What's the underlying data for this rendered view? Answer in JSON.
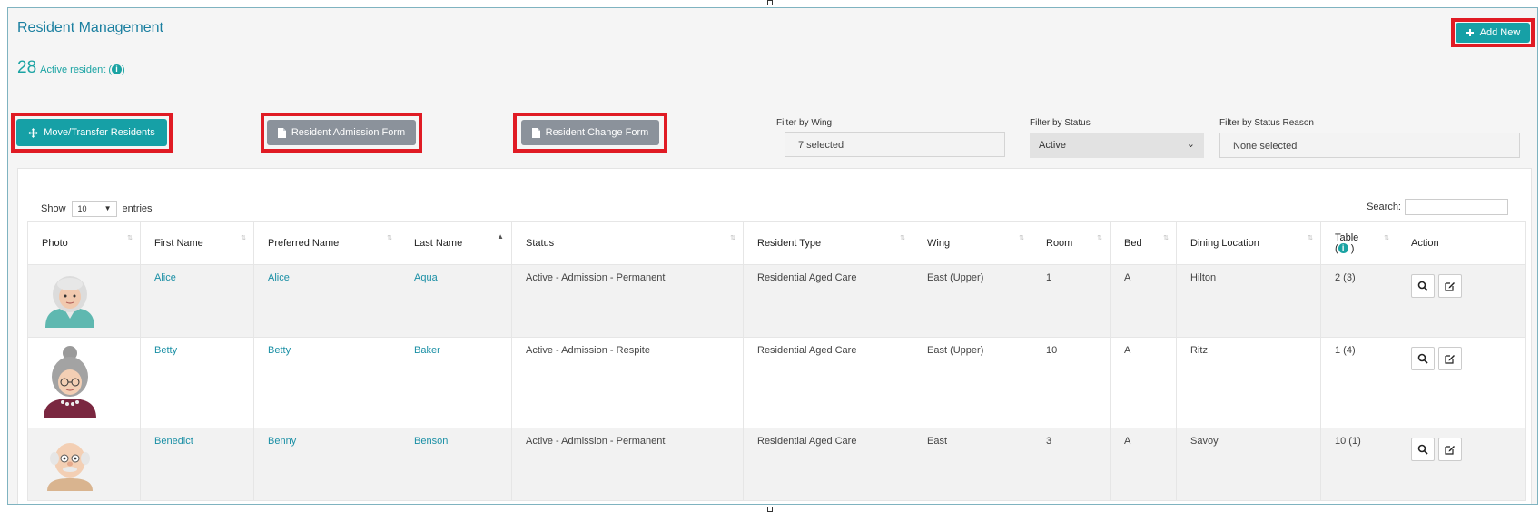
{
  "page": {
    "title": "Resident Management",
    "active_count": "28",
    "active_label": "Active resident (",
    "active_label_end": ")"
  },
  "buttons": {
    "add_new": "Add New",
    "move_transfer": "Move/Transfer Residents",
    "admission_form": "Resident Admission Form",
    "change_form": "Resident Change Form"
  },
  "filters": {
    "wing_label": "Filter by Wing",
    "wing_value": "7 selected",
    "status_label": "Filter by Status",
    "status_value": "Active",
    "reason_label": "Filter by Status Reason",
    "reason_value": "None selected"
  },
  "table_controls": {
    "show_label": "Show",
    "entries_value": "10",
    "entries_label": "entries",
    "search_label": "Search:"
  },
  "columns": [
    "Photo",
    "First Name",
    "Preferred Name",
    "Last Name",
    "Status",
    "Resident Type",
    "Wing",
    "Room",
    "Bed",
    "Dining Location",
    "Table",
    "Action"
  ],
  "rows": [
    {
      "first": "Alice",
      "preferred": "Alice",
      "last": "Aqua",
      "status": "Active - Admission - Permanent",
      "type": "Residential Aged Care",
      "wing": "East (Upper)",
      "room": "1",
      "bed": "A",
      "dining": "Hilton",
      "table": "2 (3)"
    },
    {
      "first": "Betty",
      "preferred": "Betty",
      "last": "Baker",
      "status": "Active - Admission - Respite",
      "type": "Residential Aged Care",
      "wing": "East (Upper)",
      "room": "10",
      "bed": "A",
      "dining": "Ritz",
      "table": "1 (4)"
    },
    {
      "first": "Benedict",
      "preferred": "Benny",
      "last": "Benson",
      "status": "Active - Admission - Permanent",
      "type": "Residential Aged Care",
      "wing": "East",
      "room": "3",
      "bed": "A",
      "dining": "Savoy",
      "table": "10 (1)"
    }
  ],
  "colors": {
    "accent": "#16a0a6",
    "title": "#1a7fa0",
    "highlight": "#e01b24",
    "grey_button": "#8b929b",
    "link": "#1a8fa5"
  },
  "icons": [
    "plus-icon",
    "move-icon",
    "document-icon",
    "info-icon",
    "caret-down-icon",
    "search-icon",
    "edit-icon",
    "sort-icon"
  ]
}
